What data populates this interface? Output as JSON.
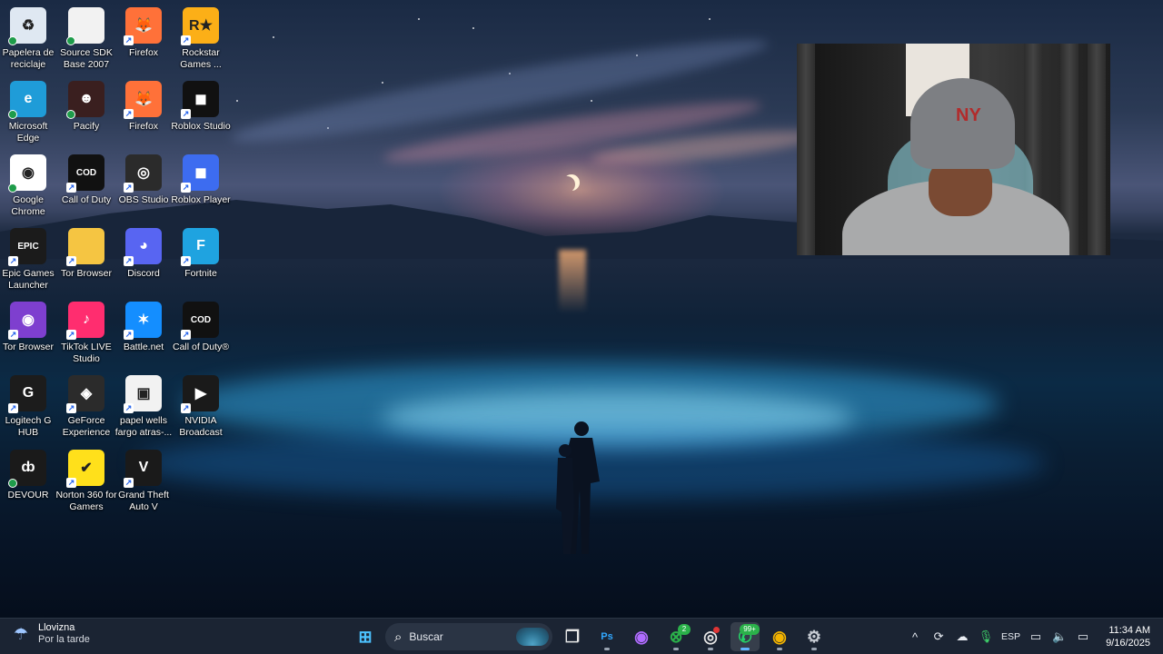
{
  "desktop": {
    "icons": [
      {
        "label": "Papelera de reciclaje",
        "icon": "recycle-bin-icon",
        "color": "#dfe8f2",
        "glyph": "♻"
      },
      {
        "label": "Source SDK Base 2007",
        "icon": "blank-file-icon",
        "color": "#f2f2f2",
        "glyph": ""
      },
      {
        "label": "Firefox",
        "icon": "firefox-icon",
        "color": "#ff7139",
        "glyph": "🦊"
      },
      {
        "label": "Rockstar Games ...",
        "icon": "rockstar-icon",
        "color": "#fcaf17",
        "glyph": "R★"
      },
      {
        "label": "Microsoft Edge",
        "icon": "edge-icon",
        "color": "#1f9cd8",
        "glyph": "e"
      },
      {
        "label": "Pacify",
        "icon": "pacify-icon",
        "color": "#3a1f1f",
        "glyph": "☻"
      },
      {
        "label": "Firefox",
        "icon": "firefox-icon",
        "color": "#ff7139",
        "glyph": "🦊"
      },
      {
        "label": "Roblox Studio",
        "icon": "roblox-studio-icon",
        "color": "#111111",
        "glyph": "◼"
      },
      {
        "label": "Google Chrome",
        "icon": "chrome-icon",
        "color": "#ffffff",
        "glyph": "◉"
      },
      {
        "label": "Call of Duty",
        "icon": "call-of-duty-icon",
        "color": "#111111",
        "glyph": "COD"
      },
      {
        "label": "OBS Studio",
        "icon": "obs-icon",
        "color": "#2b2b2b",
        "glyph": "◎"
      },
      {
        "label": "Roblox Player",
        "icon": "roblox-icon",
        "color": "#3d6cf0",
        "glyph": "◼"
      },
      {
        "label": "Epic Games Launcher",
        "icon": "epic-games-icon",
        "color": "#1b1b1b",
        "glyph": "EPIC"
      },
      {
        "label": "Tor Browser",
        "icon": "folder-icon",
        "color": "#f5c542",
        "glyph": ""
      },
      {
        "label": "Discord",
        "icon": "discord-icon",
        "color": "#5865f2",
        "glyph": "◕"
      },
      {
        "label": "Fortnite",
        "icon": "fortnite-icon",
        "color": "#1fa3e0",
        "glyph": "F"
      },
      {
        "label": "Tor Browser",
        "icon": "tor-browser-icon",
        "color": "#7e3fcf",
        "glyph": "◉"
      },
      {
        "label": "TikTok LIVE Studio",
        "icon": "tiktok-live-icon",
        "color": "#ff2d6f",
        "glyph": "♪"
      },
      {
        "label": "Battle.net",
        "icon": "battlenet-icon",
        "color": "#148eff",
        "glyph": "✶"
      },
      {
        "label": "Call of Duty®",
        "icon": "call-of-duty-icon",
        "color": "#111111",
        "glyph": "COD"
      },
      {
        "label": "Logitech G HUB",
        "icon": "logitech-g-icon",
        "color": "#1c1c1c",
        "glyph": "G"
      },
      {
        "label": "GeForce Experience",
        "icon": "geforce-icon",
        "color": "#2b2b2b",
        "glyph": "◈"
      },
      {
        "label": "papel wells fargo atras-...",
        "icon": "image-file-icon",
        "color": "#f2f2f2",
        "glyph": "▣"
      },
      {
        "label": "NVIDIA Broadcast",
        "icon": "nvidia-broadcast-icon",
        "color": "#1a1a1a",
        "glyph": "▶"
      },
      {
        "label": "DEVOUR",
        "icon": "devour-icon",
        "color": "#1a1a1a",
        "glyph": "ȸ"
      },
      {
        "label": "Norton 360 for Gamers",
        "icon": "norton-icon",
        "color": "#ffe01b",
        "glyph": "✔"
      },
      {
        "label": "Grand Theft Auto V",
        "icon": "gta-v-icon",
        "color": "#1a1a1a",
        "glyph": "V"
      }
    ]
  },
  "webcam": {
    "cap_logo": "NY"
  },
  "taskbar": {
    "weather": {
      "title": "Llovizna",
      "subtitle": "Por la tarde",
      "icon": "drizzle-icon"
    },
    "search_placeholder": "Buscar",
    "apps": [
      {
        "name": "start-button",
        "icon": "windows-icon",
        "glyph": "⊞",
        "color": "#4cc2ff",
        "badge": null,
        "active": false,
        "running": false
      },
      {
        "name": "task-view-button",
        "icon": "task-view-icon",
        "glyph": "❐",
        "color": "#e6e6e6",
        "badge": null,
        "active": false,
        "running": false
      },
      {
        "name": "photoshop-button",
        "icon": "photoshop-icon",
        "glyph": "Ps",
        "color": "#31a8ff",
        "badge": null,
        "active": false,
        "running": true
      },
      {
        "name": "copilot-button",
        "icon": "copilot-icon",
        "glyph": "◉",
        "color": "#b06cff",
        "badge": null,
        "active": false,
        "running": false
      },
      {
        "name": "xbox-button",
        "icon": "xbox-icon",
        "glyph": "⊗",
        "color": "#2bb14a",
        "badge": "2",
        "active": false,
        "running": true
      },
      {
        "name": "obs-taskbar-button",
        "icon": "obs-icon",
        "glyph": "◎",
        "color": "#e6e6e6",
        "badge": "dot",
        "active": false,
        "running": true
      },
      {
        "name": "whatsapp-button",
        "icon": "whatsapp-icon",
        "glyph": "✆",
        "color": "#25d366",
        "badge": "99+",
        "active": true,
        "running": true
      },
      {
        "name": "chrome-taskbar-button",
        "icon": "chrome-icon",
        "glyph": "◉",
        "color": "#f4b400",
        "badge": null,
        "active": false,
        "running": true
      },
      {
        "name": "settings-button",
        "icon": "gear-icon",
        "glyph": "⚙",
        "color": "#c7ccd4",
        "badge": null,
        "active": false,
        "running": true
      }
    ],
    "tray": {
      "items": [
        {
          "name": "show-hidden-icons",
          "icon": "chevron-up-icon",
          "glyph": "^"
        },
        {
          "name": "sync-tray-icon",
          "icon": "sync-icon",
          "glyph": "⟳"
        },
        {
          "name": "onedrive-tray-icon",
          "icon": "cloud-icon",
          "glyph": "☁"
        },
        {
          "name": "microphone-tray-icon",
          "icon": "microphone-icon",
          "glyph": "🎙"
        }
      ],
      "language": "ESP",
      "status_items": [
        {
          "name": "network-tray-icon",
          "icon": "network-icon",
          "glyph": "▭"
        },
        {
          "name": "volume-tray-icon",
          "icon": "speaker-icon",
          "glyph": "🔈"
        },
        {
          "name": "battery-tray-icon",
          "icon": "battery-icon",
          "glyph": "▭"
        }
      ],
      "time": "11:34 AM",
      "date": "9/16/2025"
    }
  }
}
